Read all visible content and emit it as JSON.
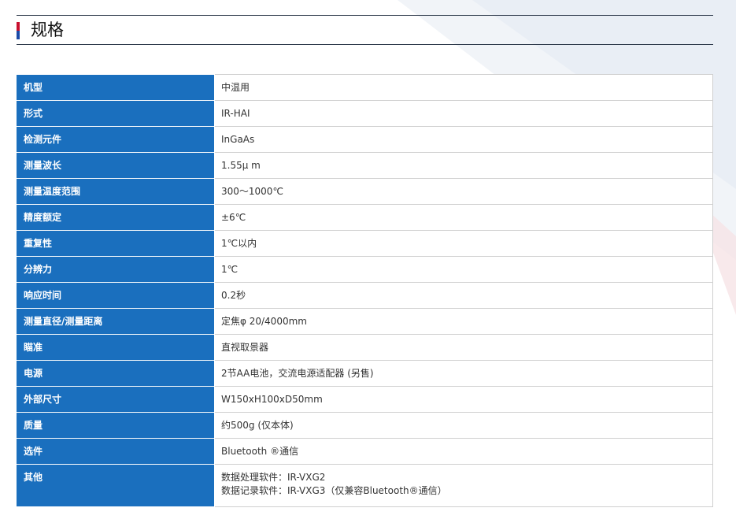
{
  "section": {
    "title": "规格"
  },
  "specs": [
    {
      "label": "机型",
      "value": "中温用"
    },
    {
      "label": "形式",
      "value": "IR-HAI"
    },
    {
      "label": "检测元件",
      "value": "InGaAs"
    },
    {
      "label": "测量波长",
      "value": "1.55μ m"
    },
    {
      "label": "测量温度范围",
      "value": "300～1000℃"
    },
    {
      "label": "精度额定",
      "value": "±6℃"
    },
    {
      "label": "重复性",
      "value": "1℃以内"
    },
    {
      "label": "分辨力",
      "value": "1℃"
    },
    {
      "label": "响应时间",
      "value": "0.2秒"
    },
    {
      "label": "测量直径/测量距离",
      "value": "定焦φ 20/4000mm"
    },
    {
      "label": "瞄准",
      "value": "直视取景器"
    },
    {
      "label": "电源",
      "value": "2节AA电池，交流电源适配器 (另售)"
    },
    {
      "label": "外部尺寸",
      "value": "W150xH100xD50mm"
    },
    {
      "label": "质量",
      "value": "约500g (仅本体)"
    },
    {
      "label": "选件",
      "value": "Bluetooth ®通信"
    },
    {
      "label": "其他",
      "lines": [
        "数据处理软件：IR-VXG2",
        "数据记录软件：IR-VXG3（仅兼容Bluetooth®通信）"
      ]
    }
  ],
  "colors": {
    "header_cell": "#1a6fbe",
    "accent_red": "#c8102e",
    "accent_blue": "#1a4aa8"
  }
}
